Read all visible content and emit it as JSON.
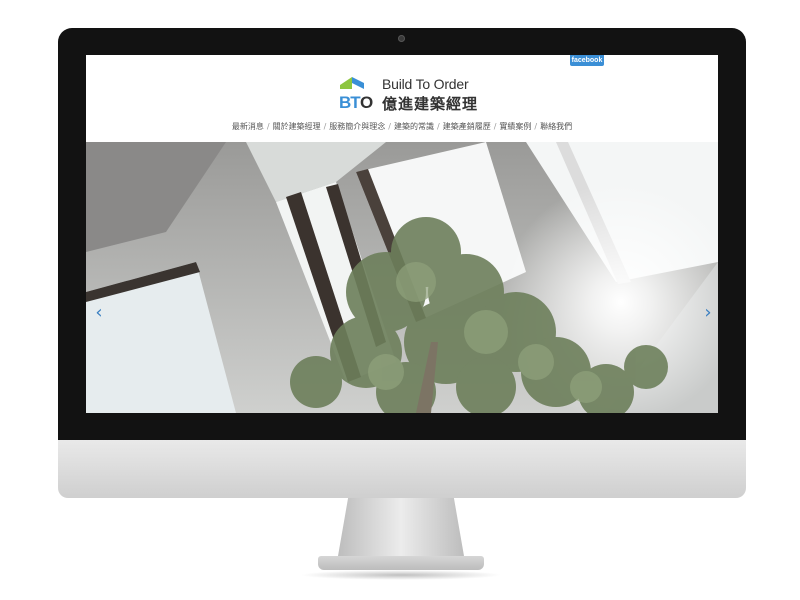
{
  "site": {
    "logo": {
      "short": "BTO",
      "english": "Build To Order",
      "chinese": "億進建築經理",
      "colors": {
        "green": "#8dc63f",
        "blue": "#3a8fd6",
        "dark": "#333333"
      }
    },
    "facebook_label": "facebook",
    "nav": {
      "items": [
        "最新消息",
        "關於建築經理",
        "服務簡介與理念",
        "建築的常識",
        "建築產銷履歷",
        "實績案例",
        "聯絡我們"
      ],
      "separator": "/"
    },
    "hero": {
      "prev_icon": "chevron-left-icon",
      "next_icon": "chevron-right-icon",
      "prev_glyph": "‹",
      "next_glyph": "›",
      "accent": "#3a7fc1"
    }
  }
}
